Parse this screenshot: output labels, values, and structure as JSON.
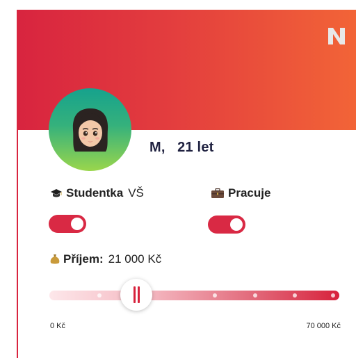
{
  "brand": {
    "logo_letter": "N",
    "logo_color": "#e8e8e8"
  },
  "profile": {
    "gender": "M,",
    "age": "21 let",
    "avatar_icon": "woman-emoji-avatar"
  },
  "student": {
    "icon": "graduation-cap-icon",
    "label": "Studentka",
    "detail": "VŠ",
    "toggle_on": true
  },
  "work": {
    "icon": "briefcase-icon",
    "label": "Pracuje",
    "toggle_on": true
  },
  "income": {
    "icon": "money-bag-icon",
    "label": "Příjem:",
    "value": "21 000 Kč",
    "slider_fraction": 0.3,
    "min_label": "0 Kč",
    "max_label": "70 000 Kč"
  },
  "colors": {
    "accent": "#d8253f",
    "gradient_start": "#d8243f",
    "gradient_end": "#f26437",
    "avatar_gradient_top": "#16a28d",
    "avatar_gradient_bottom": "#9ad64c",
    "name_text": "#1f2140"
  }
}
